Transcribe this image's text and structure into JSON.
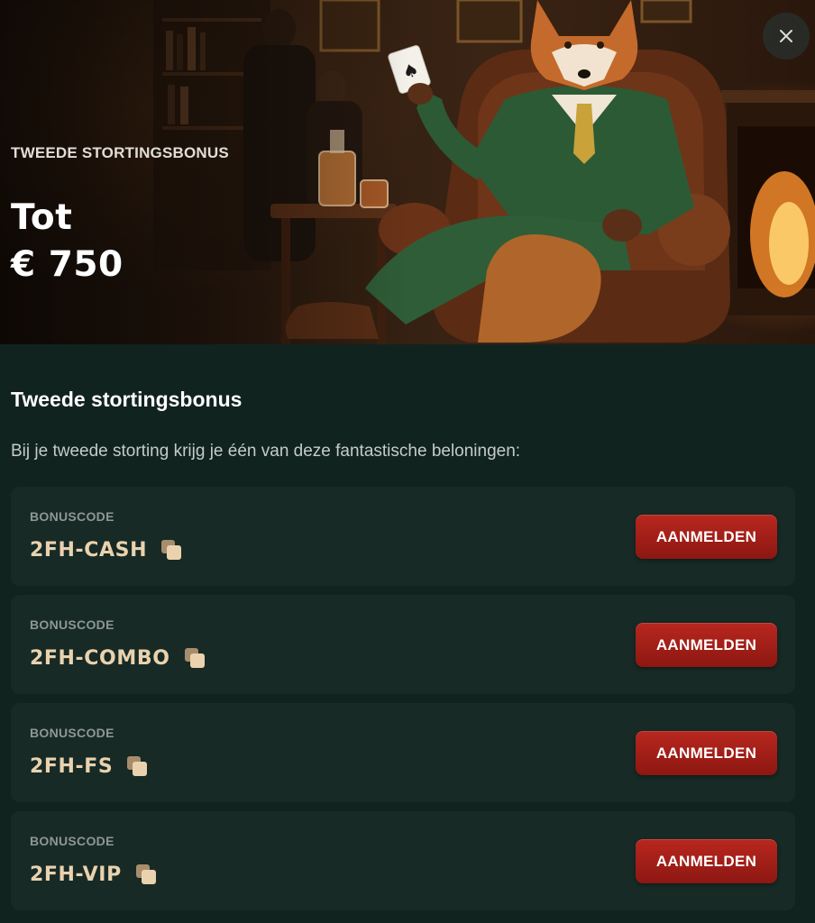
{
  "hero": {
    "eyebrow": "TWEEDE STORTINGSBONUS",
    "title_line1": "Tot",
    "title_line2": "€ 750"
  },
  "close_label": "×",
  "section": {
    "title": "Tweede stortingsbonus",
    "description": "Bij je tweede storting krijg je één van deze fantastische beloningen:"
  },
  "bonuses": [
    {
      "label": "BONUSCODE",
      "code": "2FH-CASH",
      "button": "AANMELDEN"
    },
    {
      "label": "BONUSCODE",
      "code": "2FH-COMBO",
      "button": "AANMELDEN"
    },
    {
      "label": "BONUSCODE",
      "code": "2FH-FS",
      "button": "AANMELDEN"
    },
    {
      "label": "BONUSCODE",
      "code": "2FH-VIP",
      "button": "AANMELDEN"
    }
  ],
  "colors": {
    "background": "#11231f",
    "card": "#172a26",
    "code_text": "#ead2ae",
    "button": "#a81f19"
  },
  "icons": {
    "close": "close-icon",
    "copy": "copy-icon"
  }
}
